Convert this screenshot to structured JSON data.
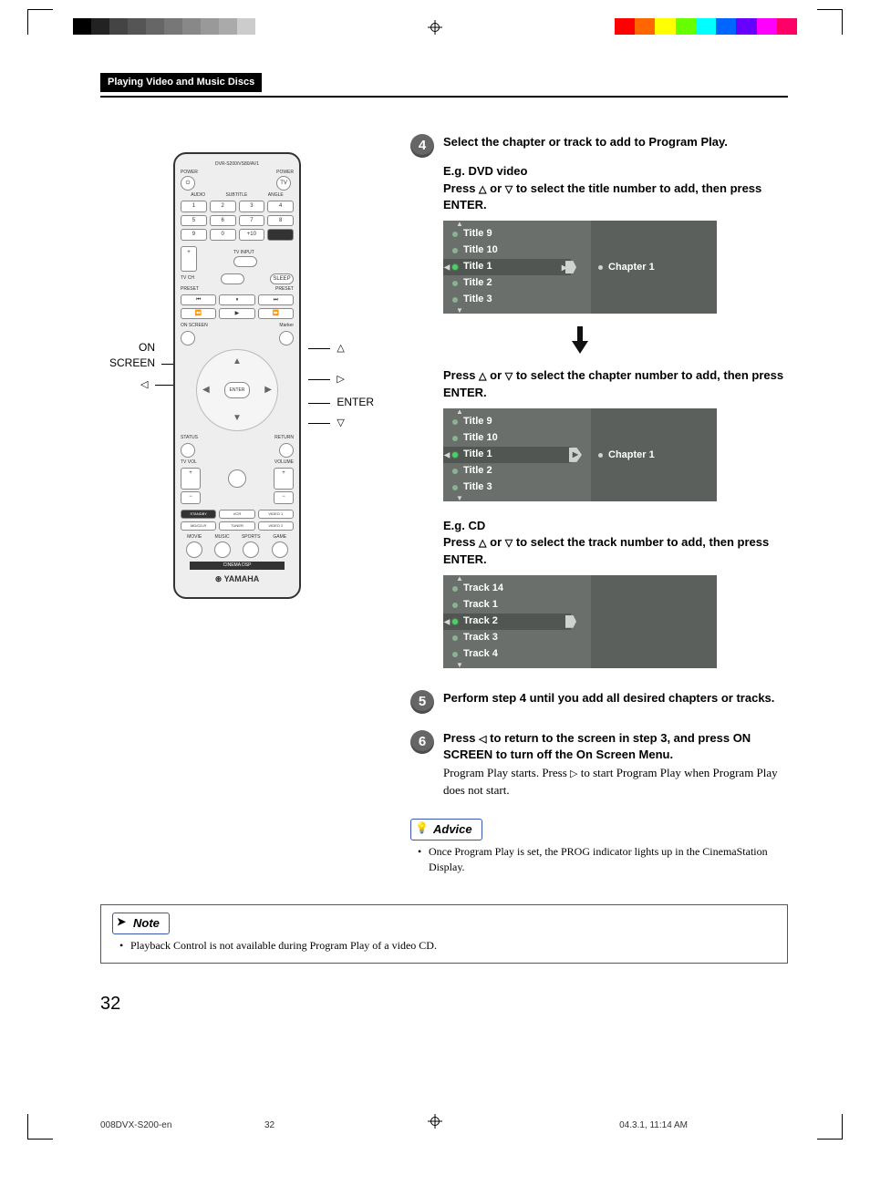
{
  "header": {
    "section": "Playing Video and Music Discs"
  },
  "remote": {
    "labels": {
      "on_screen": "ON\nSCREEN",
      "enter": "ENTER",
      "brand": "YAMAHA",
      "model": "DVR-S200/VS80/AV1"
    },
    "callout_arrows": {
      "up": "△",
      "down": "▽",
      "left": "◁",
      "right": "▷"
    },
    "buttons": {
      "power_l": "POWER",
      "power_r": "POWER",
      "tv": "TV",
      "audio": "AUDIO",
      "subtitle": "SUBTITLE",
      "angle": "ANGLE",
      "nums": [
        "1",
        "2",
        "3",
        "4",
        "5",
        "6",
        "7",
        "8",
        "9",
        "0",
        "+10"
      ],
      "tv_input": "TV INPUT",
      "sleep": "SLEEP",
      "tv_ch": "TV CH",
      "preset": "PRESET",
      "status": "STATUS",
      "return": "RETURN",
      "tv_vol": "TV VOL",
      "volume": "VOLUME",
      "marker": "Marker",
      "dpad_enter": "ENTER",
      "on_screen_btn": "ON SCREEN",
      "inputs": [
        "STANDBY",
        "VCR",
        "VIDEO 1",
        "MD/CD-R",
        "TUNER",
        "VIDEO 2"
      ],
      "modes": [
        "MOVIE",
        "MUSIC",
        "SPORTS",
        "GAME"
      ],
      "cinema": "CINEMA DSP"
    }
  },
  "steps": {
    "s4": {
      "num": "4",
      "title": "Select the chapter or track to add to Program Play.",
      "dvd_heading": "E.g. DVD video",
      "dvd_line1_a": "Press ",
      "dvd_line1_b": " or ",
      "dvd_line1_c": " to select the title number to add, then press ENTER.",
      "osd1": {
        "left": [
          "Title 9",
          "Title 10",
          "Title 1",
          "Title 2",
          "Title 3"
        ],
        "selected_index": 2,
        "right_label": "Chapter 1",
        "right_cursor": "right-of-left"
      },
      "dvd_line2_a": "Press ",
      "dvd_line2_b": " or ",
      "dvd_line2_c": " to select the chapter number to add, then press ENTER.",
      "osd2": {
        "left": [
          "Title 9",
          "Title 10",
          "Title 1",
          "Title 2",
          "Title 3"
        ],
        "selected_index": 2,
        "right_label": "Chapter 1",
        "right_cursor": "on-right"
      },
      "cd_heading": "E.g. CD",
      "cd_line_a": "Press ",
      "cd_line_b": " or ",
      "cd_line_c": " to select the track number to add, then press ENTER.",
      "osd3": {
        "left": [
          "Track 14",
          "Track 1",
          "Track 2",
          "Track 3",
          "Track 4"
        ],
        "selected_index": 2,
        "right_label": "",
        "right_cursor": "right-of-left"
      }
    },
    "s5": {
      "num": "5",
      "title": "Perform step 4 until you add all desired chapters or tracks."
    },
    "s6": {
      "num": "6",
      "title_a": "Press ",
      "title_b": " to return to the screen in step 3, and press ON SCREEN to turn off the On Screen Menu.",
      "body_a": "Program Play starts. Press ",
      "body_b": " to start Program Play when Program Play does not start."
    }
  },
  "advice": {
    "label": "Advice",
    "items": [
      "Once Program Play is set, the PROG indicator lights up in the CinemaStation Display."
    ]
  },
  "note": {
    "label": "Note",
    "items": [
      "Playback Control is not available during Program Play of a video CD."
    ]
  },
  "page_number": "32",
  "footer": {
    "file": "008DVX-S200-en",
    "page": "32",
    "datetime": "04.3.1, 11:14 AM"
  }
}
